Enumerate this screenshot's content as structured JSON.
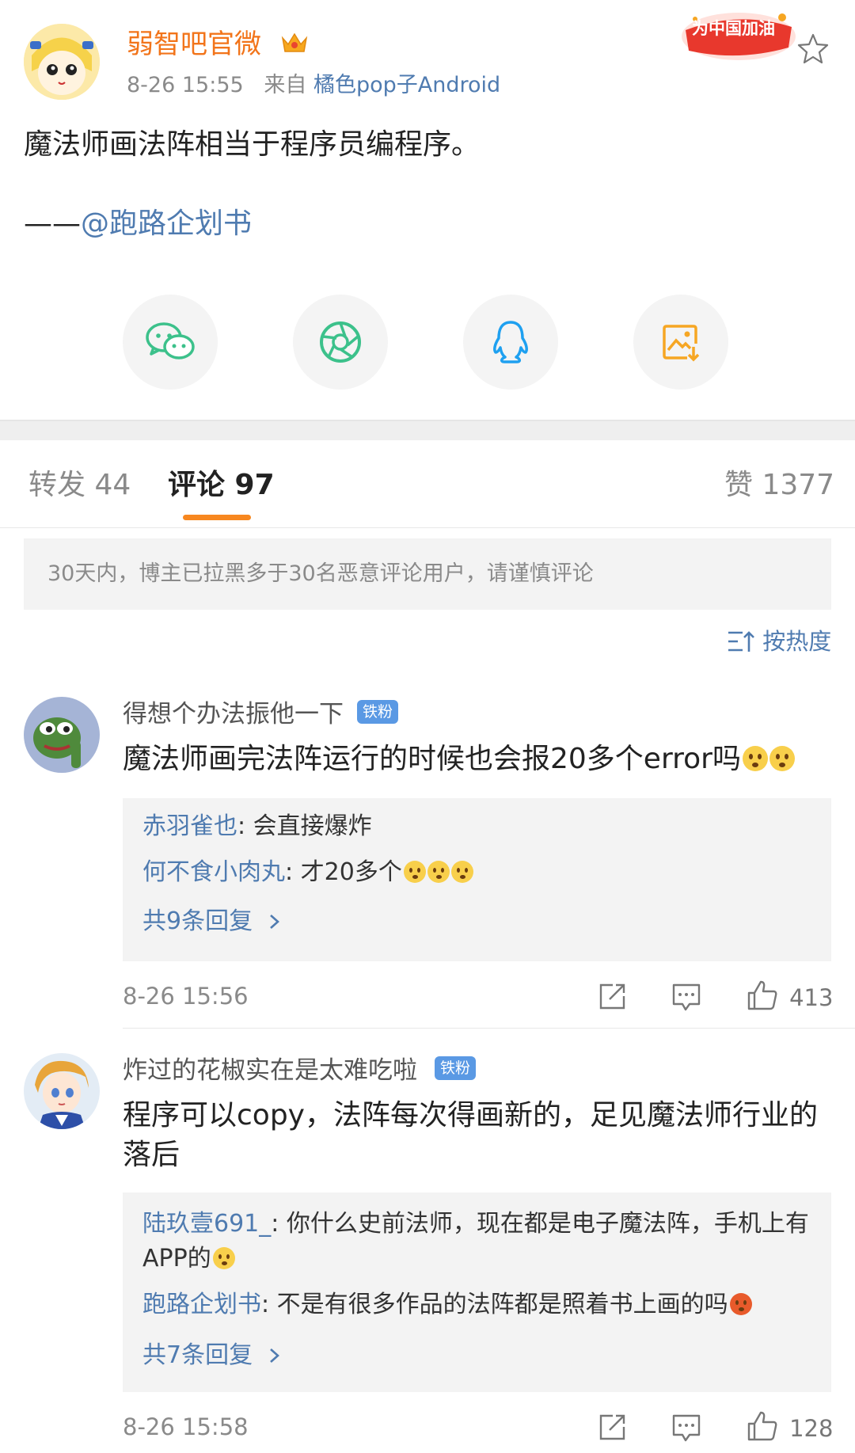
{
  "colors": {
    "accent": "#f7871f",
    "link": "#4f7bb0",
    "author": "#f2741a"
  },
  "post": {
    "author": "弱智吧官微",
    "time": "8-26 15:55",
    "source_prefix": "来自",
    "source": "橘色pop子Android",
    "event_badge": "为中国加油",
    "text": "魔法师画法阵相当于程序员编程序。",
    "mention_dash": "——",
    "mention": "@跑路企划书"
  },
  "share": [
    {
      "icon": "wechat-icon"
    },
    {
      "icon": "moments-icon"
    },
    {
      "icon": "qq-icon"
    },
    {
      "icon": "save-image-icon"
    }
  ],
  "tabs": {
    "repost": "转发 44",
    "comments": "评论 97",
    "likes": "赞 1377"
  },
  "notice": "30天内，博主已拉黑多于30名恶意评论用户，请谨慎评论",
  "sort_label": "按热度",
  "comments": [
    {
      "user": "得想个办法振他一下",
      "badge": "铁粉",
      "text": "魔法师画完法阵运行的时候也会报20多个error吗",
      "replies": [
        {
          "user": "赤羽雀也",
          "text": ": 会直接爆炸"
        },
        {
          "user": "何不食小肉丸",
          "text": ": 才20多个"
        }
      ],
      "more": "共9条回复",
      "time": "8-26 15:56",
      "likes": "413"
    },
    {
      "user": "炸过的花椒实在是太难吃啦",
      "badge": "铁粉",
      "text": "程序可以copy，法阵每次得画新的，足见魔法师行业的落后",
      "replies": [
        {
          "user": "陆玖壹691_",
          "text": ": 你什么史前法师，现在都是电子魔法阵，手机上有APP的"
        },
        {
          "user": "跑路企划书",
          "text": ": 不是有很多作品的法阵都是照着书上画的吗"
        }
      ],
      "more": "共7条回复",
      "time": "8-26 15:58",
      "likes": "128"
    }
  ]
}
